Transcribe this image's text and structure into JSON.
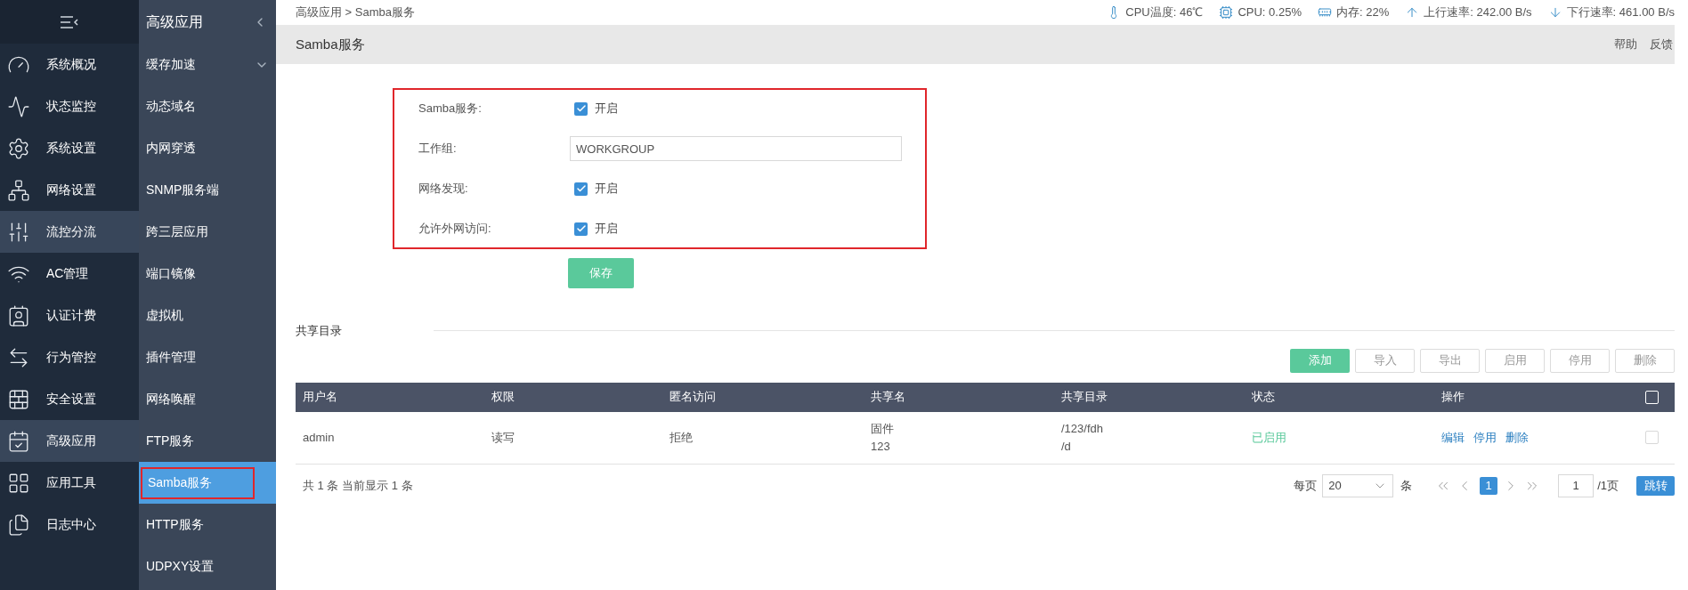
{
  "sidebar": {
    "items": [
      {
        "label": "系统概况",
        "selected": false
      },
      {
        "label": "状态监控",
        "selected": false
      },
      {
        "label": "系统设置",
        "selected": false
      },
      {
        "label": "网络设置",
        "selected": false
      },
      {
        "label": "流控分流",
        "selected": true
      },
      {
        "label": "AC管理",
        "selected": false
      },
      {
        "label": "认证计费",
        "selected": false
      },
      {
        "label": "行为管控",
        "selected": false
      },
      {
        "label": "安全设置",
        "selected": false
      },
      {
        "label": "高级应用",
        "selected": true
      },
      {
        "label": "应用工具",
        "selected": false
      },
      {
        "label": "日志中心",
        "selected": false
      }
    ]
  },
  "submenu": {
    "title": "高级应用",
    "items": [
      {
        "label": "缓存加速",
        "kind": "group",
        "selected": false,
        "annotated": false
      },
      {
        "label": "动态域名",
        "kind": "link",
        "selected": false,
        "annotated": false
      },
      {
        "label": "内网穿透",
        "kind": "link",
        "selected": false,
        "annotated": false
      },
      {
        "label": "SNMP服务端",
        "kind": "link",
        "selected": false,
        "annotated": false
      },
      {
        "label": "跨三层应用",
        "kind": "link",
        "selected": false,
        "annotated": false
      },
      {
        "label": "端口镜像",
        "kind": "link",
        "selected": false,
        "annotated": false
      },
      {
        "label": "虚拟机",
        "kind": "link",
        "selected": false,
        "annotated": false
      },
      {
        "label": "插件管理",
        "kind": "link",
        "selected": false,
        "annotated": false
      },
      {
        "label": "网络唤醒",
        "kind": "link",
        "selected": false,
        "annotated": false
      },
      {
        "label": "FTP服务",
        "kind": "link",
        "selected": false,
        "annotated": false
      },
      {
        "label": "Samba服务",
        "kind": "link",
        "selected": true,
        "annotated": true
      },
      {
        "label": "HTTP服务",
        "kind": "link",
        "selected": false,
        "annotated": false
      },
      {
        "label": "UDPXY设置",
        "kind": "link",
        "selected": false,
        "annotated": false
      }
    ]
  },
  "breadcrumb": {
    "items": [
      "高级应用",
      "Samba服务"
    ],
    "separator": ">"
  },
  "status": [
    {
      "kind": "temperature",
      "text": "CPU温度: 46℃"
    },
    {
      "kind": "cpu",
      "text": "CPU: 0.25%"
    },
    {
      "kind": "memory",
      "text": "内存: 22%"
    },
    {
      "kind": "upload",
      "text": "上行速率: 242.00 B/s"
    },
    {
      "kind": "download",
      "text": "下行速率: 461.00 B/s"
    }
  ],
  "page_header": {
    "title": "Samba服务",
    "links": [
      "帮助",
      "反馈"
    ]
  },
  "form": {
    "annotated": true,
    "fields": [
      {
        "kind": "checkbox",
        "label": "Samba服务:",
        "checked": true,
        "text": "开启"
      },
      {
        "kind": "text",
        "label": "工作组:",
        "value": "WORKGROUP"
      },
      {
        "kind": "checkbox",
        "label": "网络发现:",
        "checked": true,
        "text": "开启"
      },
      {
        "kind": "checkbox",
        "label": "允许外网访问:",
        "checked": true,
        "text": "开启"
      }
    ],
    "save": "保存"
  },
  "shares": {
    "title": "共享目录",
    "buttons": [
      {
        "label": "添加",
        "primary": true
      },
      {
        "label": "导入",
        "primary": false
      },
      {
        "label": "导出",
        "primary": false
      },
      {
        "label": "启用",
        "primary": false
      },
      {
        "label": "停用",
        "primary": false
      },
      {
        "label": "删除",
        "primary": false
      }
    ],
    "columns": [
      "用户名",
      "权限",
      "匿名访问",
      "共享名",
      "共享目录",
      "状态",
      "操作"
    ],
    "header_checked": false,
    "rows": [
      {
        "cells": [
          "admin",
          "读写",
          "拒绝",
          "固件\n123",
          "/123/fdh\n/d"
        ],
        "status": "已启用",
        "enabled": true,
        "actions": [
          "编辑",
          "停用",
          "删除"
        ],
        "checked": false
      }
    ],
    "summary": "共 1 条 当前显示 1 条"
  },
  "pagination": {
    "per_page_label": "每页",
    "per_page": "20",
    "unit": "条",
    "pages": [
      {
        "label": "1",
        "selected": true
      }
    ],
    "page_input": "1",
    "total": "/1页",
    "go": "跳转"
  }
}
